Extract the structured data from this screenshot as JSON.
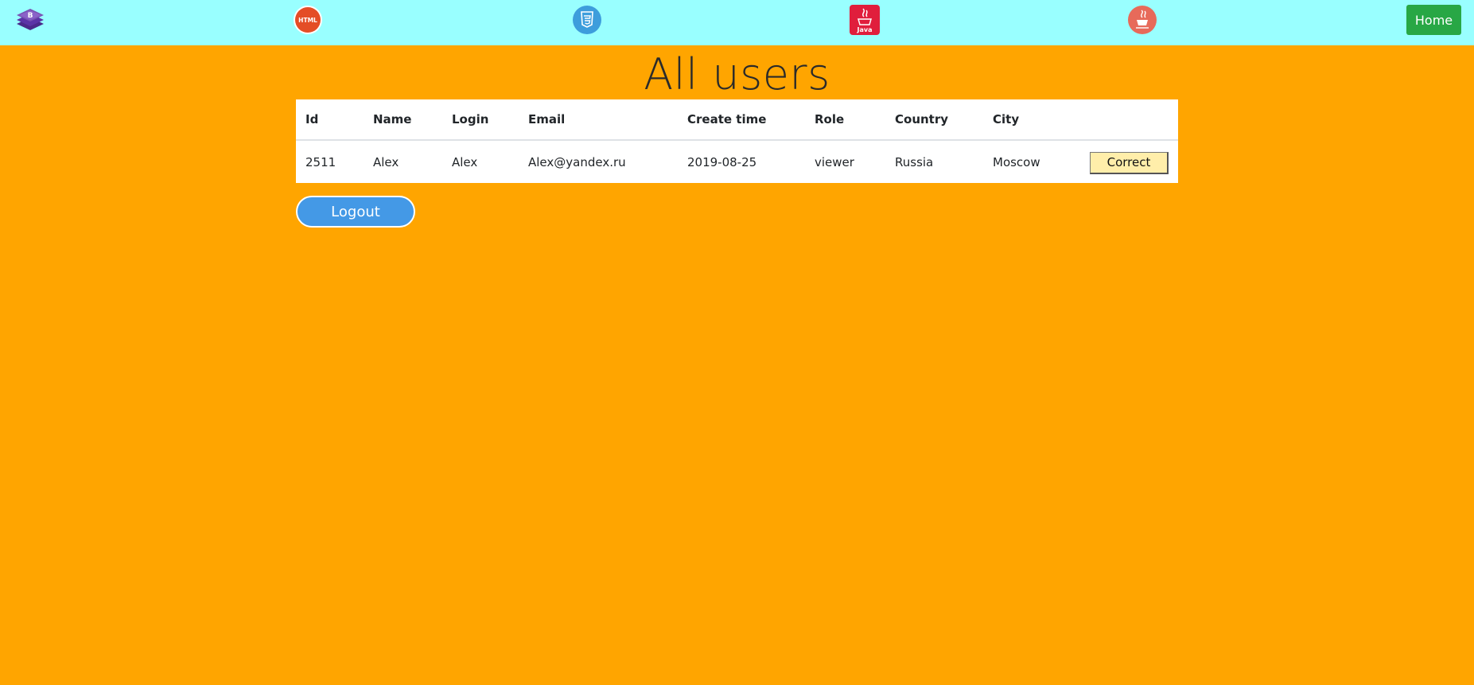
{
  "nav": {
    "icons": [
      "bootstrap-icon",
      "html5-icon",
      "css3-icon",
      "java-icon",
      "java-cup-icon"
    ],
    "html_icon_text": "HTML",
    "java_icon_text": "Java",
    "home_label": "Home"
  },
  "page": {
    "title": "All users"
  },
  "table": {
    "headers": [
      "Id",
      "Name",
      "Login",
      "Email",
      "Create time",
      "Role",
      "Country",
      "City"
    ],
    "rows": [
      {
        "id": "2511",
        "name": "Alex",
        "login": "Alex",
        "email": "Alex@yandex.ru",
        "create_time": "2019-08-25",
        "role": "viewer",
        "country": "Russia",
        "city": "Moscow",
        "action_label": "Correct"
      }
    ]
  },
  "logout_label": "Logout",
  "colors": {
    "background": "#ffa500",
    "topbar": "#99ffff",
    "home_button": "#28a745",
    "logout_button": "#4499e6",
    "correct_button": "#ffeeaa"
  }
}
